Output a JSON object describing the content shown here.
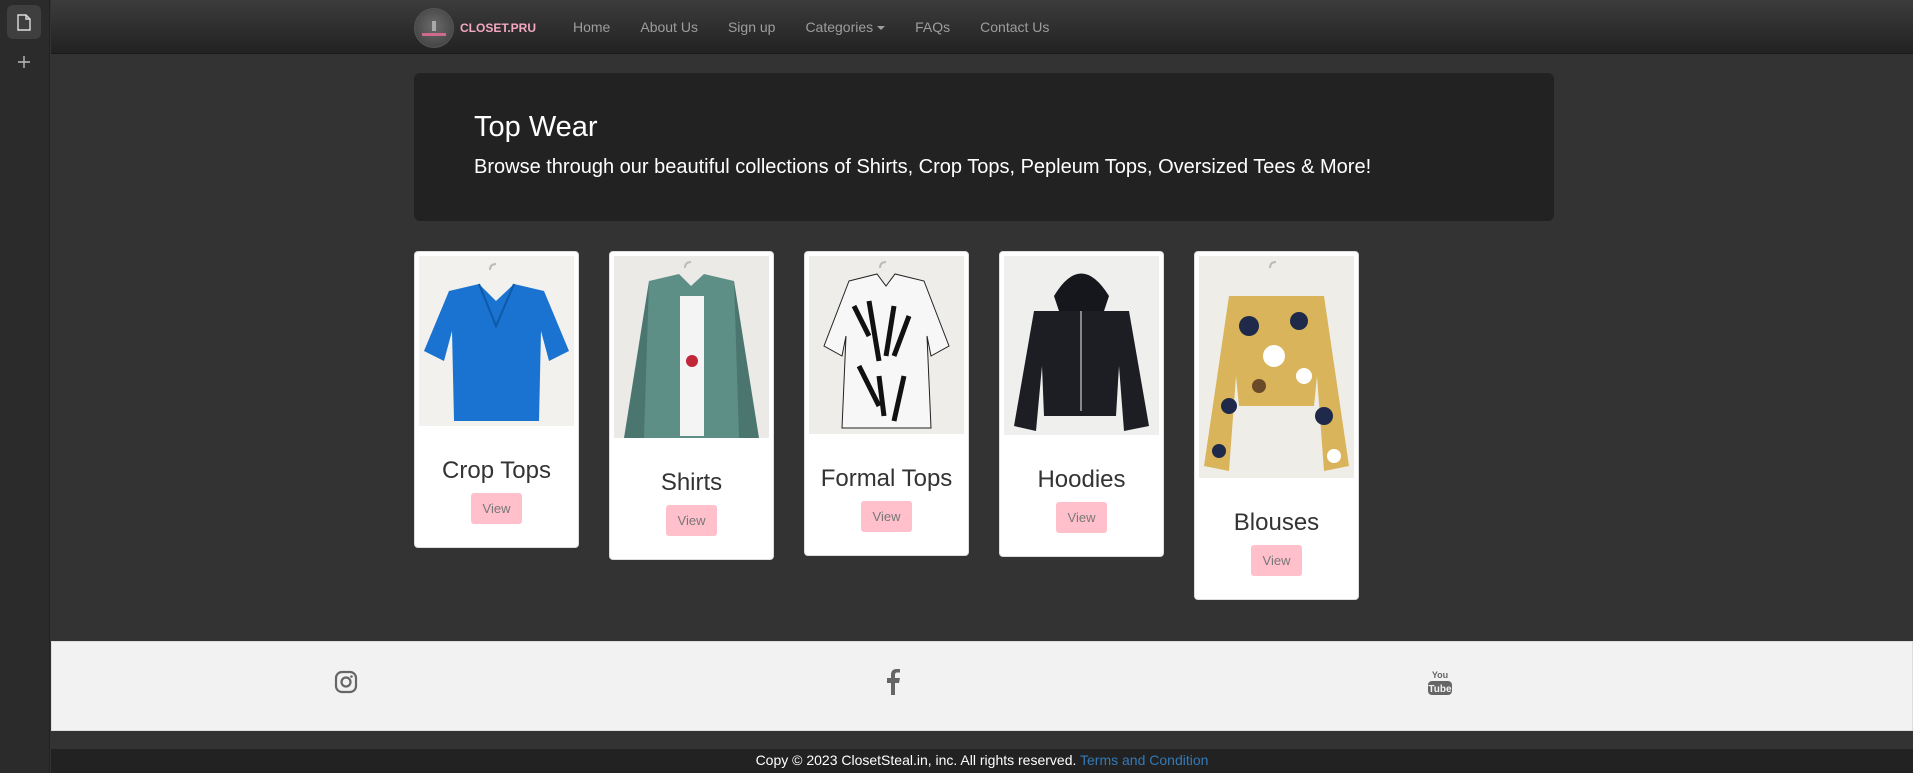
{
  "brand": {
    "name": "CLOSET.PRU"
  },
  "nav": {
    "items": [
      "Home",
      "About Us",
      "Sign up",
      "Categories",
      "FAQs",
      "Contact Us"
    ]
  },
  "jumbotron": {
    "title": "Top Wear",
    "subtitle": "Browse through our beautiful collections of Shirts, Crop Tops, Pepleum Tops, Oversized Tees & More!"
  },
  "cards": [
    {
      "title": "Crop Tops",
      "button": "View"
    },
    {
      "title": "Shirts",
      "button": "View"
    },
    {
      "title": "Formal Tops",
      "button": "View"
    },
    {
      "title": "Hoodies",
      "button": "View"
    },
    {
      "title": "Blouses",
      "button": "View"
    }
  ],
  "footer": {
    "social": [
      "instagram-icon",
      "facebook-icon",
      "youtube-icon"
    ],
    "copyright": "Copy © 2023 ClosetSteal.in, inc. All rights reserved.",
    "terms_link": "Terms and Condition"
  },
  "colors": {
    "accent_button": "#ffc0cb",
    "brand_text": "#f4a7c0",
    "link": "#337ab7"
  }
}
